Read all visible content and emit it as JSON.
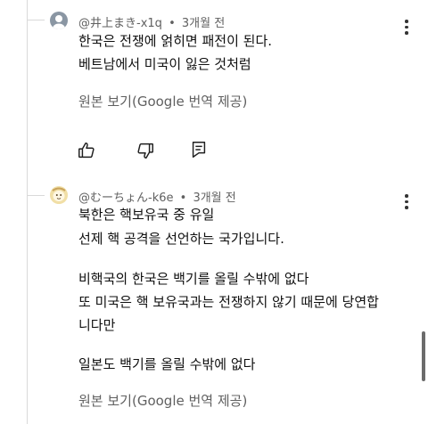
{
  "comments": [
    {
      "author": "@井上まき-x1q",
      "time": "3개월 전",
      "lines": [
        "한국은 전쟁에 얽히면 패전이 된다.",
        "베트남에서 미국이 잃은 것처럼"
      ],
      "translate": "원본 보기(Google 번역 제공)"
    },
    {
      "author": "@むーちょん-k6e",
      "time": "3개월 전",
      "lines": [
        "북한은 핵보유국 중 유일",
        "선제 핵 공격을 선언하는 국가입니다.",
        "비핵국의 한국은 백기를 올릴 수밖에 없다",
        "또 미국은 핵 보유국과는 전쟁하지 않기 때문에 당연합",
        "니다만",
        "일본도 백기를 올릴 수밖에 없다"
      ],
      "translate": "원본 보기(Google 번역 제공)"
    }
  ],
  "separator": "•",
  "icons": [
    "like-icon",
    "dislike-icon",
    "reply-icon",
    "more-vert-icon"
  ]
}
